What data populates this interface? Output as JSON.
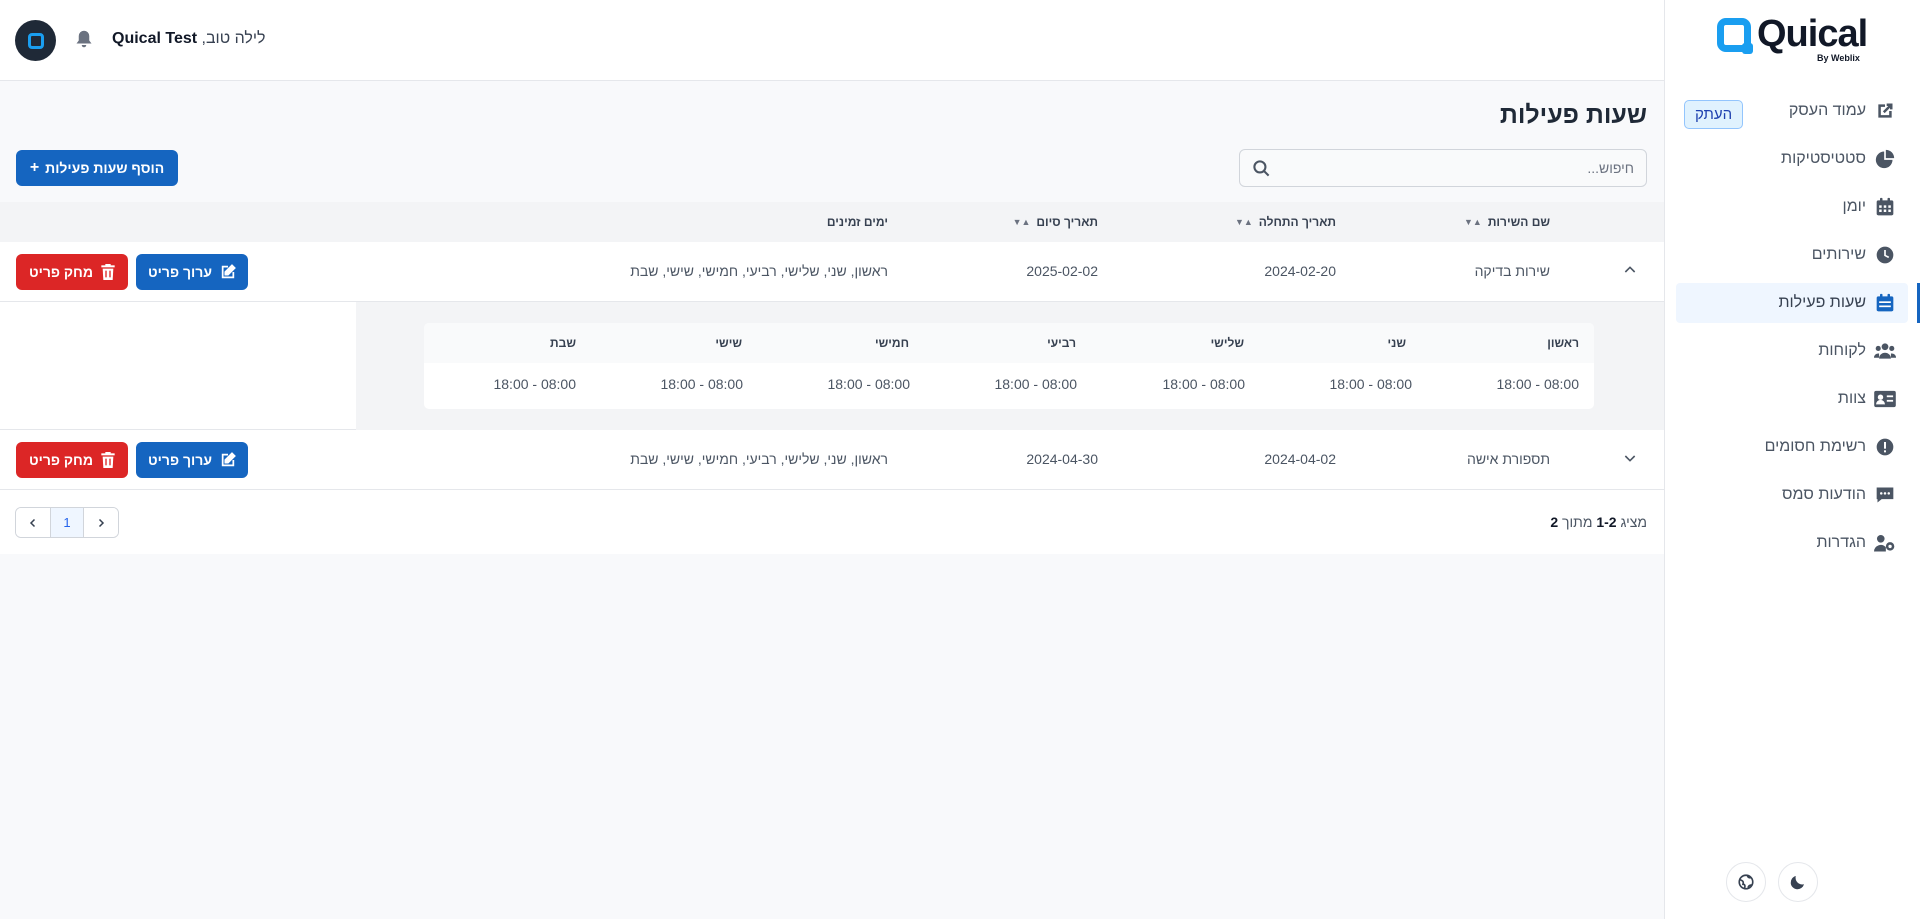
{
  "brand": {
    "name": "Quical",
    "sub": "By Weblix"
  },
  "header": {
    "greeting": "לילה טוב,",
    "user": "Quical Test"
  },
  "sidebar": {
    "copy_label": "העתק",
    "items": [
      {
        "label": "עמוד העסק",
        "icon": "external-link-icon"
      },
      {
        "label": "סטטיסטיקות",
        "icon": "pie-chart-icon"
      },
      {
        "label": "יומן",
        "icon": "calendar-grid-icon"
      },
      {
        "label": "שירותים",
        "icon": "clock-icon"
      },
      {
        "label": "שעות פעילות",
        "icon": "calendar-icon",
        "active": true
      },
      {
        "label": "לקוחות",
        "icon": "users-icon"
      },
      {
        "label": "צוות",
        "icon": "id-card-icon"
      },
      {
        "label": "רשימת חסומים",
        "icon": "alert-icon"
      },
      {
        "label": "הודעות סמס",
        "icon": "message-icon"
      },
      {
        "label": "הגדרות",
        "icon": "user-cog-icon"
      }
    ]
  },
  "page": {
    "title": "שעות פעילות",
    "search_placeholder": "חיפוש...",
    "add_label": "הוסף שעות פעילות"
  },
  "table": {
    "headers": {
      "service": "שם השירות",
      "start": "תאריך התחלה",
      "end": "תאריך סיום",
      "days": "ימים זמינים"
    },
    "rows": [
      {
        "service": "שירות בדיקה",
        "start": "2024-02-20",
        "end": "2025-02-02",
        "days": "ראשון, שני, שלישי, רביעי, חמישי, שישי, שבת",
        "expanded": true
      },
      {
        "service": "תספורת אישה",
        "start": "2024-04-02",
        "end": "2024-04-30",
        "days": "ראשון, שני, שלישי, רביעי, חמישי, שישי, שבת",
        "expanded": false
      }
    ],
    "edit_label": "ערוך פריט",
    "delete_label": "מחק פריט",
    "detail": {
      "days": [
        "ראשון",
        "שני",
        "שלישי",
        "רביעי",
        "חמישי",
        "שישי",
        "שבת"
      ],
      "hours": [
        "18:00 - 08:00",
        "18:00 - 08:00",
        "18:00 - 08:00",
        "18:00 - 08:00",
        "18:00 - 08:00",
        "18:00 - 08:00",
        "18:00 - 08:00"
      ]
    }
  },
  "pagination": {
    "prefix": "מציג",
    "range": "1-2",
    "of": "מתוך",
    "total": "2",
    "current_page": "1"
  },
  "colors": {
    "primary": "#1565c0",
    "danger": "#dc2626",
    "brand": "#1a9ef0"
  }
}
